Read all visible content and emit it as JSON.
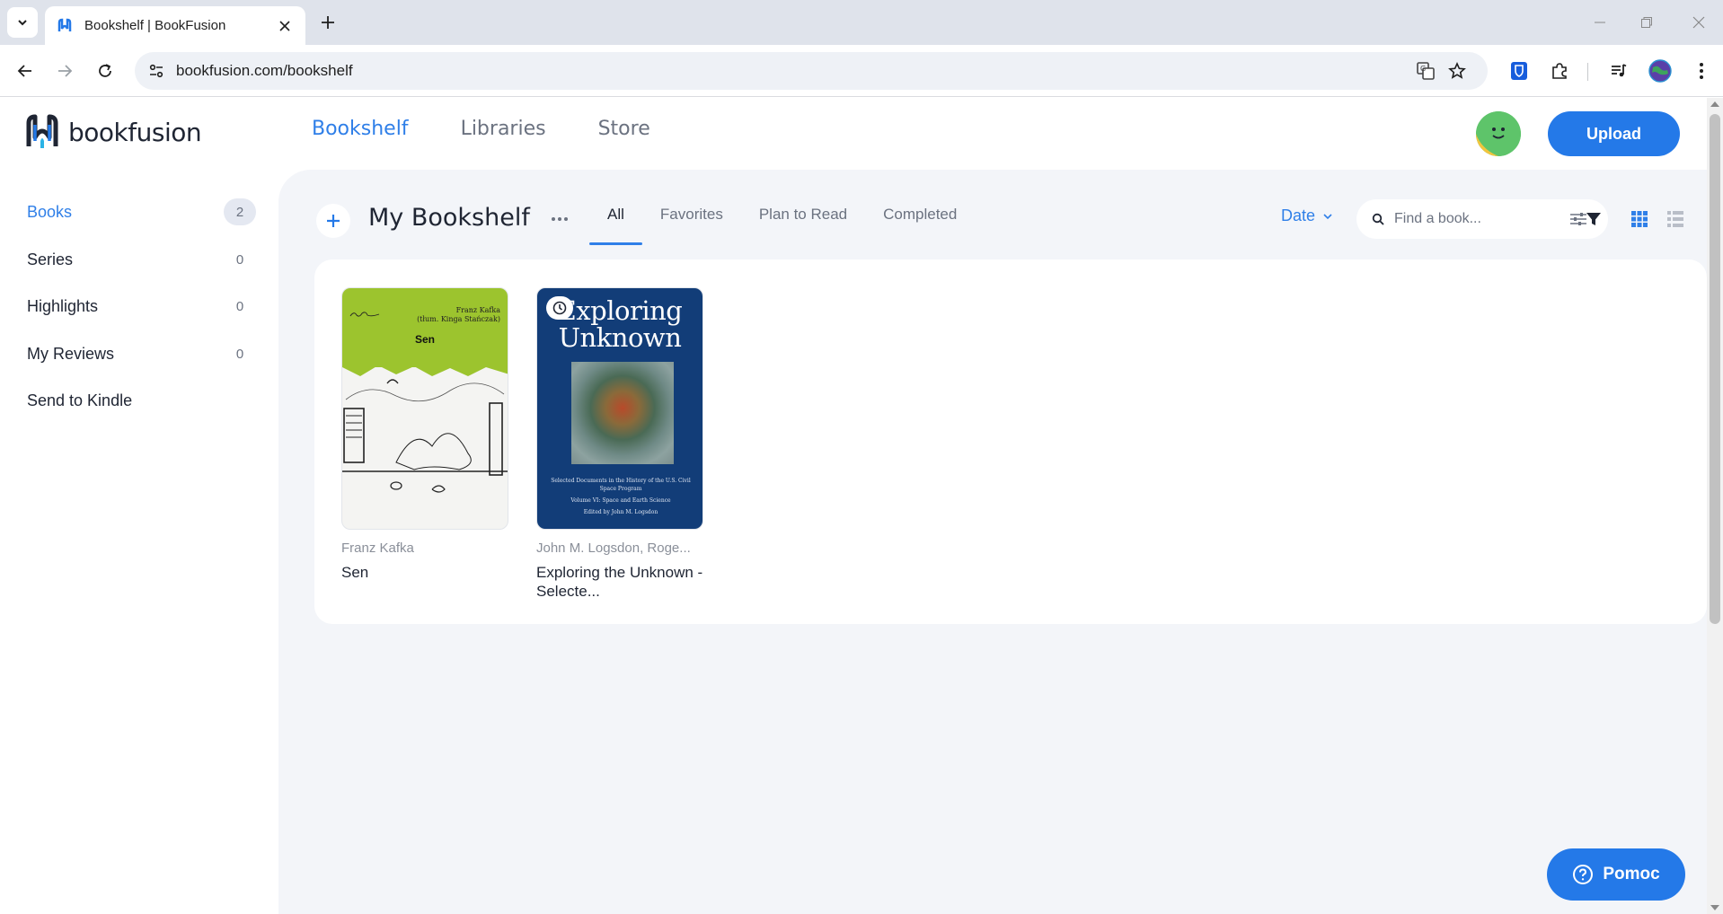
{
  "browser": {
    "tab_title": "Bookshelf | BookFusion",
    "url": "bookfusion.com/bookshelf"
  },
  "app": {
    "brand": "bookfusion",
    "nav": [
      {
        "label": "Bookshelf",
        "active": true
      },
      {
        "label": "Libraries",
        "active": false
      },
      {
        "label": "Store",
        "active": false
      }
    ],
    "upload_label": "Upload"
  },
  "sidebar": {
    "items": [
      {
        "label": "Books",
        "count": "2",
        "active": true
      },
      {
        "label": "Series",
        "count": "0",
        "active": false
      },
      {
        "label": "Highlights",
        "count": "0",
        "active": false
      },
      {
        "label": "My Reviews",
        "count": "0",
        "active": false
      },
      {
        "label": "Send to Kindle",
        "count": "",
        "active": false
      }
    ]
  },
  "shelf": {
    "title": "My Bookshelf",
    "tabs": [
      {
        "label": "All",
        "active": true
      },
      {
        "label": "Favorites",
        "active": false
      },
      {
        "label": "Plan to Read",
        "active": false
      },
      {
        "label": "Completed",
        "active": false
      }
    ],
    "sort_label": "Date",
    "search_placeholder": "Find a book..."
  },
  "books": [
    {
      "author": "Franz Kafka",
      "title": "Sen",
      "cover": {
        "title": "Sen",
        "author_line1": "Franz Kafka",
        "author_line2": "(tłum. Kinga Stańczak)",
        "color": "#9cc42e"
      }
    },
    {
      "author": "John M. Logsdon, Roge...",
      "title": "Exploring the Unknown - Selecte...",
      "cover": {
        "title_line1": "Exploring",
        "title_line2": "Unknown",
        "subtitle": "Selected Documents in the History of the U.S. Civil Space Program",
        "volume": "Volume VI: Space and Earth Science",
        "editor": "Edited by John M. Logsdon",
        "color": "#123d78"
      }
    }
  ],
  "help": {
    "label": "Pomoc"
  },
  "colors": {
    "accent": "#2479e8",
    "link": "#2f7fe8",
    "content_bg": "#f3f5f9"
  }
}
